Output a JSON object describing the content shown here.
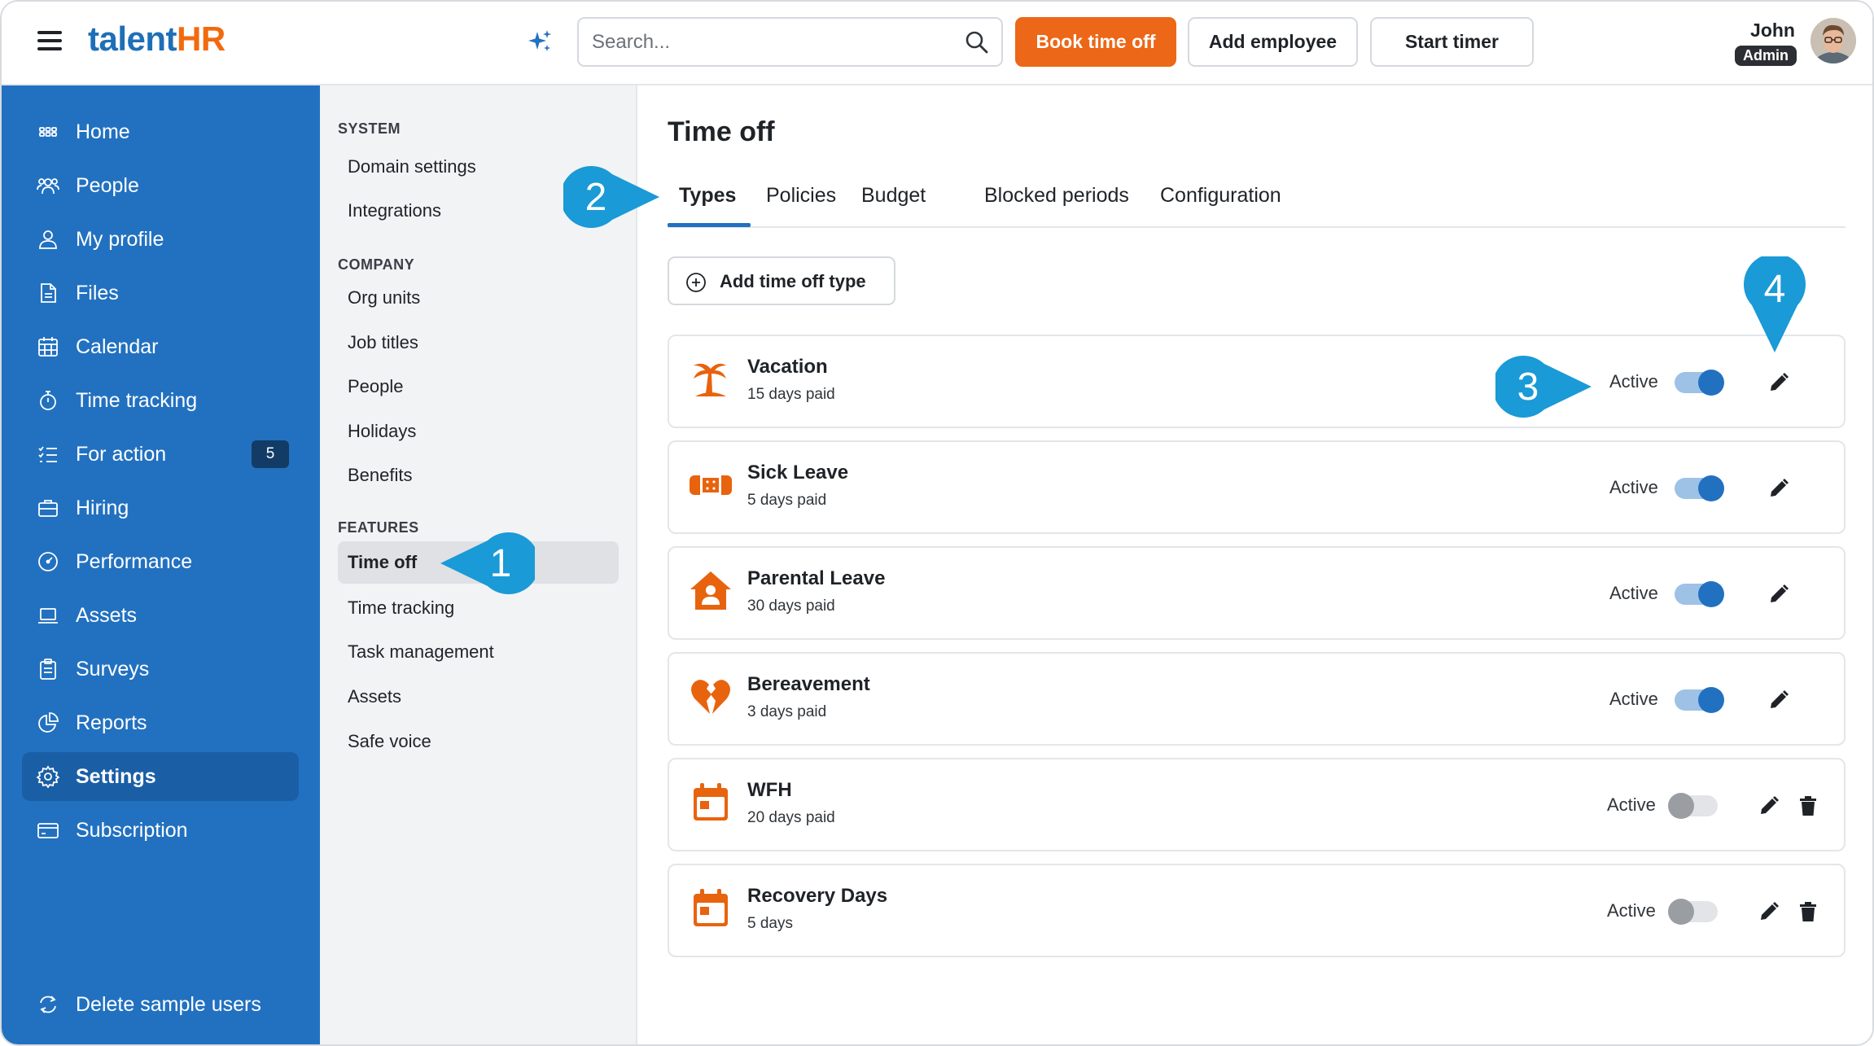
{
  "brand": {
    "part1": "talent",
    "part2": "HR"
  },
  "search": {
    "placeholder": "Search..."
  },
  "header_buttons": {
    "book": "Book time off",
    "add_employee": "Add employee",
    "start_timer": "Start timer"
  },
  "user": {
    "name": "John",
    "role": "Admin"
  },
  "sidebar": {
    "items": [
      {
        "label": "Home",
        "icon": "grid-icon"
      },
      {
        "label": "People",
        "icon": "people-icon"
      },
      {
        "label": "My profile",
        "icon": "user-icon"
      },
      {
        "label": "Files",
        "icon": "file-icon"
      },
      {
        "label": "Calendar",
        "icon": "calendar-icon"
      },
      {
        "label": "Time tracking",
        "icon": "stopwatch-icon"
      },
      {
        "label": "For action",
        "icon": "checklist-icon",
        "badge": "5"
      },
      {
        "label": "Hiring",
        "icon": "briefcase-icon"
      },
      {
        "label": "Performance",
        "icon": "gauge-icon"
      },
      {
        "label": "Assets",
        "icon": "laptop-icon"
      },
      {
        "label": "Surveys",
        "icon": "clipboard-icon"
      },
      {
        "label": "Reports",
        "icon": "pie-chart-icon"
      },
      {
        "label": "Settings",
        "icon": "gear-icon",
        "active": true
      },
      {
        "label": "Subscription",
        "icon": "credit-card-icon"
      }
    ],
    "bottom": {
      "label": "Delete sample users",
      "icon": "refresh-icon"
    }
  },
  "submenu": {
    "system": {
      "heading": "SYSTEM",
      "items": [
        "Domain settings",
        "Integrations"
      ]
    },
    "company": {
      "heading": "COMPANY",
      "items": [
        "Org units",
        "Job titles",
        "People",
        "Holidays",
        "Benefits"
      ]
    },
    "features": {
      "heading": "FEATURES",
      "items": [
        "Time off",
        "Time tracking",
        "Task management",
        "Assets",
        "Safe voice"
      ],
      "active": "Time off"
    }
  },
  "main": {
    "title": "Time off",
    "tabs": [
      "Types",
      "Policies",
      "Budget",
      "Blocked periods",
      "Configuration"
    ],
    "active_tab": "Types",
    "add_button": "Add time off type",
    "types": [
      {
        "name": "Vacation",
        "days": "15 days paid",
        "status": "Active",
        "enabled": true,
        "icon": "palm-tree-icon",
        "deletable": false
      },
      {
        "name": "Sick Leave",
        "days": "5 days paid",
        "status": "Active",
        "enabled": true,
        "icon": "bandage-icon",
        "deletable": false
      },
      {
        "name": "Parental Leave",
        "days": "30 days paid",
        "status": "Active",
        "enabled": true,
        "icon": "house-parent-icon",
        "deletable": false
      },
      {
        "name": "Bereavement",
        "days": "3 days paid",
        "status": "Active",
        "enabled": true,
        "icon": "broken-heart-icon",
        "deletable": false
      },
      {
        "name": "WFH",
        "days": "20 days paid",
        "status": "Active",
        "enabled": false,
        "icon": "calendar-icon",
        "deletable": true
      },
      {
        "name": "Recovery Days",
        "days": "5 days",
        "status": "Active",
        "enabled": false,
        "icon": "calendar-icon",
        "deletable": true
      }
    ]
  },
  "callouts": [
    "1",
    "2",
    "3",
    "4"
  ],
  "colors": {
    "brand_blue": "#2271c0",
    "brand_orange": "#ec6717",
    "callout_blue": "#1a9ad6",
    "icon_orange": "#e8630e"
  }
}
